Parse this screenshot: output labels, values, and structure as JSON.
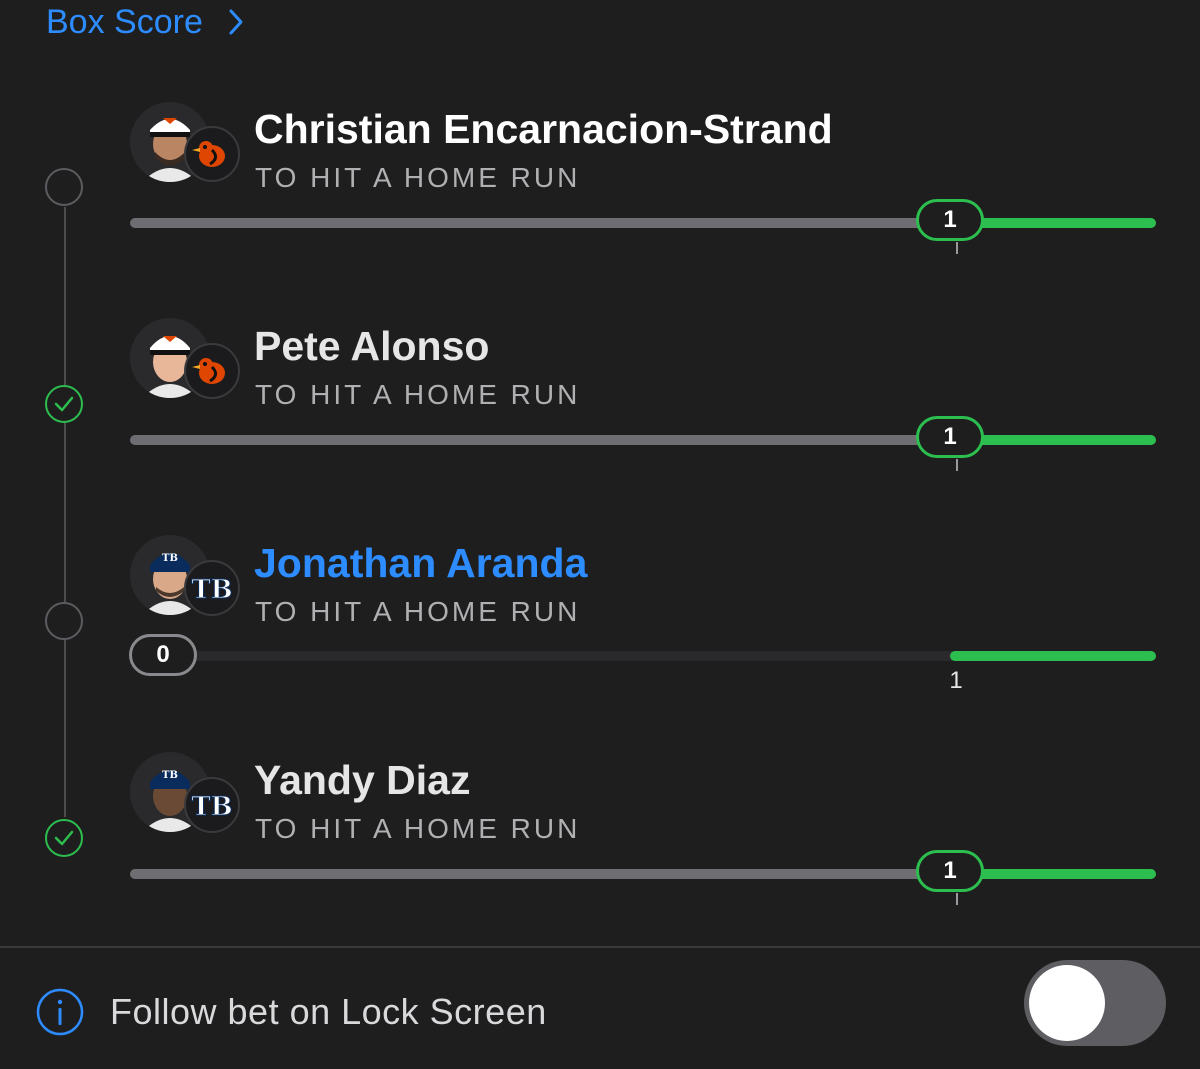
{
  "header": {
    "box_score_label": "Box Score"
  },
  "legs": [
    {
      "player": "Christian Encarnacion-Strand",
      "market": "TO HIT A HOME RUN",
      "team": "Orioles",
      "team_logo": "orioles-bird-icon",
      "status": "pending",
      "name_style": "link",
      "progress_value": "1",
      "target": "1",
      "progress_fraction": 1.0
    },
    {
      "player": "Pete Alonso",
      "market": "TO HIT A HOME RUN",
      "team": "Orioles",
      "team_logo": "orioles-bird-icon",
      "status": "won",
      "name_style": "plain",
      "progress_value": "1",
      "target": "1",
      "progress_fraction": 1.0
    },
    {
      "player": "Jonathan Aranda",
      "market": "TO HIT A HOME RUN",
      "team": "Rays",
      "team_logo": "tb-logo-icon",
      "status": "pending",
      "name_style": "link",
      "progress_value": "0",
      "target": "1",
      "progress_fraction": 0.0
    },
    {
      "player": "Yandy Diaz",
      "market": "TO HIT A HOME RUN",
      "team": "Rays",
      "team_logo": "tb-logo-icon",
      "status": "won",
      "name_style": "plain",
      "progress_value": "1",
      "target": "1",
      "progress_fraction": 1.0
    }
  ],
  "footer": {
    "follow_label": "Follow bet on Lock Screen",
    "toggle_on": false
  },
  "colors": {
    "accent_blue": "#2d8cff",
    "success_green": "#2cbe4e",
    "background": "#1e1e1f",
    "orioles_orange": "#df4601",
    "rays_navy": "#092c5c"
  }
}
